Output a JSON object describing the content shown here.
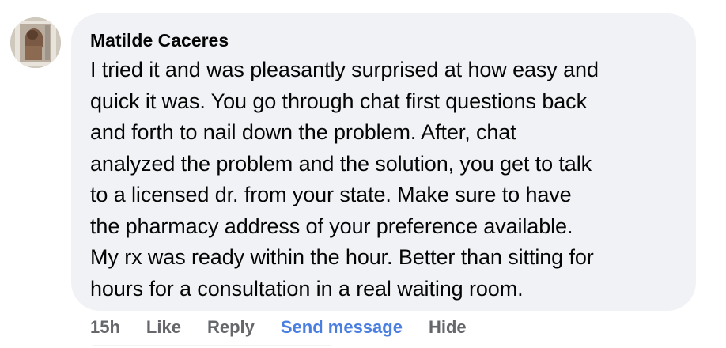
{
  "comment": {
    "author": "Matilde Caceres",
    "text": "I tried it and was pleasantly surprised at how easy and\nquick it was. You go through chat first questions back\nand forth to nail down the problem. After, chat\nanalyzed the problem and the solution, you get to talk\nto a licensed dr. from your state. Make sure to have\nthe pharmacy address of your preference available.\nMy rx was ready within the hour. Better than sitting for\nhours for a consultation in a real waiting room.",
    "avatar_icon": "profile-photo"
  },
  "actions": {
    "time": "15h",
    "like": "Like",
    "reply": "Reply",
    "send_message": "Send message",
    "hide": "Hide"
  },
  "colors": {
    "bubble_bg": "#f0f2f5",
    "text": "#050505",
    "action_text": "#65676b",
    "link_blue": "#4a7ee0"
  }
}
